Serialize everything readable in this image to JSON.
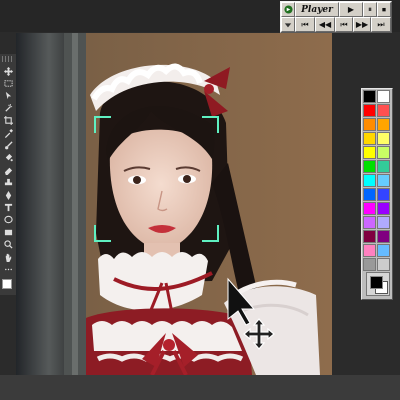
{
  "player": {
    "title": "Player",
    "top_buttons": [
      "▶",
      "⏸",
      "⏹"
    ],
    "bottom_buttons": [
      "⏮",
      "◀◀",
      "⏮",
      "▶▶",
      "⏭"
    ]
  },
  "toolbar": {
    "tools": [
      "move-tool",
      "marquee-tool",
      "lasso-tool",
      "magic-wand-tool",
      "crop-tool",
      "eyedropper-tool",
      "brush-tool",
      "paint-bucket-tool",
      "eraser-tool",
      "stamp-tool",
      "pen-tool",
      "text-tool",
      "shape-tool",
      "rectangle-tool",
      "zoom-tool",
      "hand-tool",
      "more-tools"
    ]
  },
  "palette": {
    "colors": [
      "#000000",
      "#ffffff",
      "#ff0000",
      "#ff5050",
      "#ff8c00",
      "#ffa500",
      "#ffd700",
      "#ffff66",
      "#ffff00",
      "#c8ff64",
      "#00e000",
      "#33cc99",
      "#00ffff",
      "#66ccff",
      "#0066ff",
      "#3344ff",
      "#ff00ff",
      "#9900ff",
      "#cc66ff",
      "#b0aaff",
      "#800040",
      "#800080",
      "#ff80c0",
      "#66bbff",
      "#999999",
      "#cccccc"
    ]
  }
}
